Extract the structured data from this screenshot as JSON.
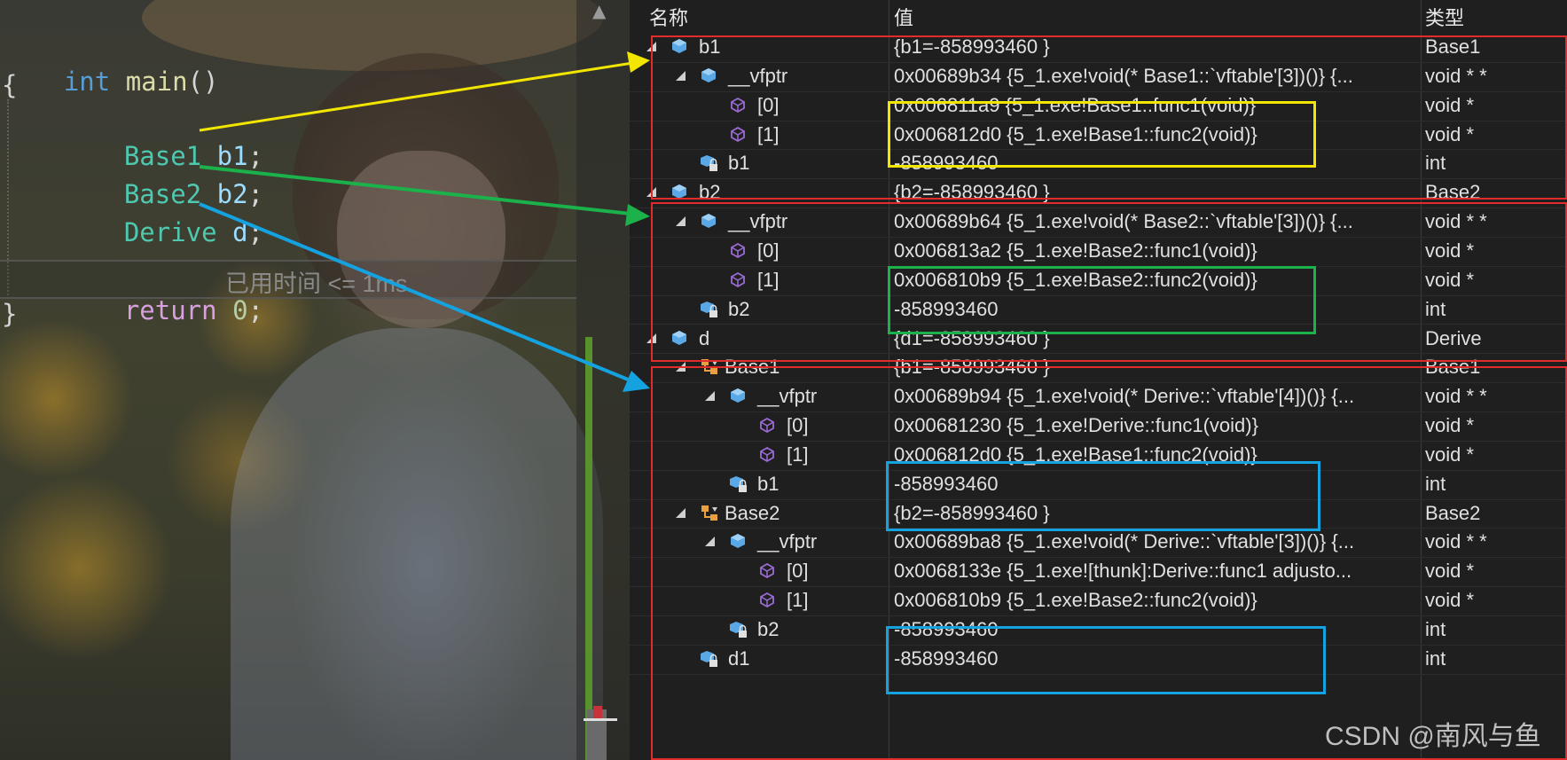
{
  "editor": {
    "lines": {
      "main_kw": "int",
      "main_name": "main",
      "main_parens": "()",
      "open_brace": "{",
      "b1_type": "Base1",
      "b1_var": "b1",
      "b2_type": "Base2",
      "b2_var": "b2",
      "d_type": "Derive",
      "d_var": "d",
      "semi": ";",
      "ret_kw": "return",
      "ret_val": "0",
      "close_brace": "}"
    },
    "elapsed": "已用时间 <= 1ms"
  },
  "watch": {
    "headers": {
      "name": "名称",
      "value": "值",
      "type": "类型"
    },
    "rows": [
      {
        "name": "b1",
        "value": "{b1=-858993460 }",
        "type": "Base1"
      },
      {
        "name": "__vfptr",
        "value": "0x00689b34 {5_1.exe!void(* Base1::`vftable'[3])()} {...",
        "type": "void * *"
      },
      {
        "name": "[0]",
        "value": "0x006811a9 {5_1.exe!Base1::func1(void)}",
        "type": "void *"
      },
      {
        "name": "[1]",
        "value": "0x006812d0 {5_1.exe!Base1::func2(void)}",
        "type": "void *"
      },
      {
        "name": "b1",
        "value": "-858993460",
        "type": "int"
      },
      {
        "name": "b2",
        "value": "{b2=-858993460 }",
        "type": "Base2"
      },
      {
        "name": "__vfptr",
        "value": "0x00689b64 {5_1.exe!void(* Base2::`vftable'[3])()} {...",
        "type": "void * *"
      },
      {
        "name": "[0]",
        "value": "0x006813a2 {5_1.exe!Base2::func1(void)}",
        "type": "void *"
      },
      {
        "name": "[1]",
        "value": "0x006810b9 {5_1.exe!Base2::func2(void)}",
        "type": "void *"
      },
      {
        "name": "b2",
        "value": "-858993460",
        "type": "int"
      },
      {
        "name": "d",
        "value": "{d1=-858993460 }",
        "type": "Derive"
      },
      {
        "name": "Base1",
        "value": "{b1=-858993460 }",
        "type": "Base1"
      },
      {
        "name": "__vfptr",
        "value": "0x00689b94 {5_1.exe!void(* Derive::`vftable'[4])()} {...",
        "type": "void * *"
      },
      {
        "name": "[0]",
        "value": "0x00681230 {5_1.exe!Derive::func1(void)}",
        "type": "void *"
      },
      {
        "name": "[1]",
        "value": "0x006812d0 {5_1.exe!Base1::func2(void)}",
        "type": "void *"
      },
      {
        "name": "b1",
        "value": "-858993460",
        "type": "int"
      },
      {
        "name": "Base2",
        "value": "{b2=-858993460 }",
        "type": "Base2"
      },
      {
        "name": "__vfptr",
        "value": "0x00689ba8 {5_1.exe!void(* Derive::`vftable'[3])()} {...",
        "type": "void * *"
      },
      {
        "name": "[0]",
        "value": "0x0068133e {5_1.exe![thunk]:Derive::func1 adjusto...",
        "type": "void *"
      },
      {
        "name": "[1]",
        "value": "0x006810b9 {5_1.exe!Base2::func2(void)}",
        "type": "void *"
      },
      {
        "name": "b2",
        "value": "-858993460",
        "type": "int"
      },
      {
        "name": "d1",
        "value": "-858993460",
        "type": "int"
      }
    ]
  },
  "watermark": "CSDN @南风与鱼",
  "colors": {
    "red_frame": "#e22b2b",
    "yellow_frame": "#f2e500",
    "green_frame": "#1bb14b",
    "blue_frame": "#14a3e0",
    "object_icon": "#5aa9e6",
    "vtable_entry_icon": "#9b6cd6",
    "field_icon": "#5aa9e6",
    "base_class_icon": "#e8a040"
  },
  "icons": {
    "expand": "triangle-expanded-icon",
    "object": "object-cube-icon",
    "vtable_entry": "vtable-entry-icon",
    "field": "field-lock-icon",
    "base_class": "base-class-icon"
  }
}
